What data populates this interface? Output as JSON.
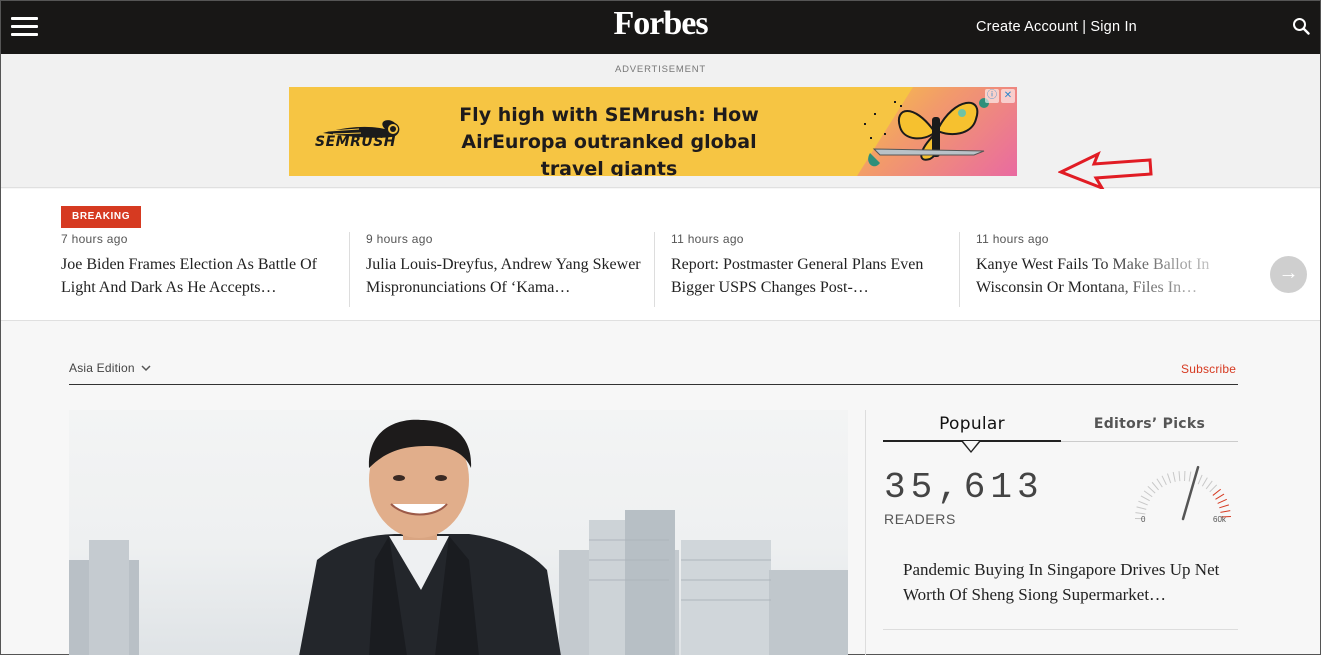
{
  "header": {
    "logo": "Forbes",
    "create_account": "Create Account",
    "divider": "|",
    "sign_in": "Sign In"
  },
  "ad": {
    "label": "ADVERTISEMENT",
    "brand": "SEMRUSH",
    "headline": "Fly high with SEMrush: How AirEuropa outranked global travel giants",
    "info_icon": "ⓘ",
    "close_icon": "✕"
  },
  "breaking": {
    "badge": "BREAKING",
    "stories": [
      {
        "time": "7 hours ago",
        "title": "Joe Biden Frames Election As Battle Of Light And Dark As He Accepts…"
      },
      {
        "time": "9 hours ago",
        "title": "Julia Louis-Dreyfus, Andrew Yang Skewer Mispronunciations Of ‘Kama…"
      },
      {
        "time": "11 hours ago",
        "title": "Report: Postmaster General Plans Even Bigger USPS Changes Post-…"
      },
      {
        "time": "11 hours ago",
        "title": "Kanye West Fails To Make Ballot In Wisconsin Or Montana, Files In…"
      }
    ],
    "next_icon": "→"
  },
  "main": {
    "edition": "Asia Edition",
    "subscribe": "Subscribe"
  },
  "sidebar": {
    "tab_popular": "Popular",
    "tab_editors": "Editors’ Picks",
    "count": "35,613",
    "readers_label": "READERS",
    "gauge_min": "0",
    "gauge_max": "60k",
    "gauge_value_fraction": 0.59,
    "popular_story": "Pandemic Buying In Singapore Drives Up Net Worth Of Sheng Siong Supermarket…"
  },
  "colors": {
    "topbar": "#181716",
    "accent_red": "#d63a21",
    "ad_yellow": "#f6c543"
  }
}
